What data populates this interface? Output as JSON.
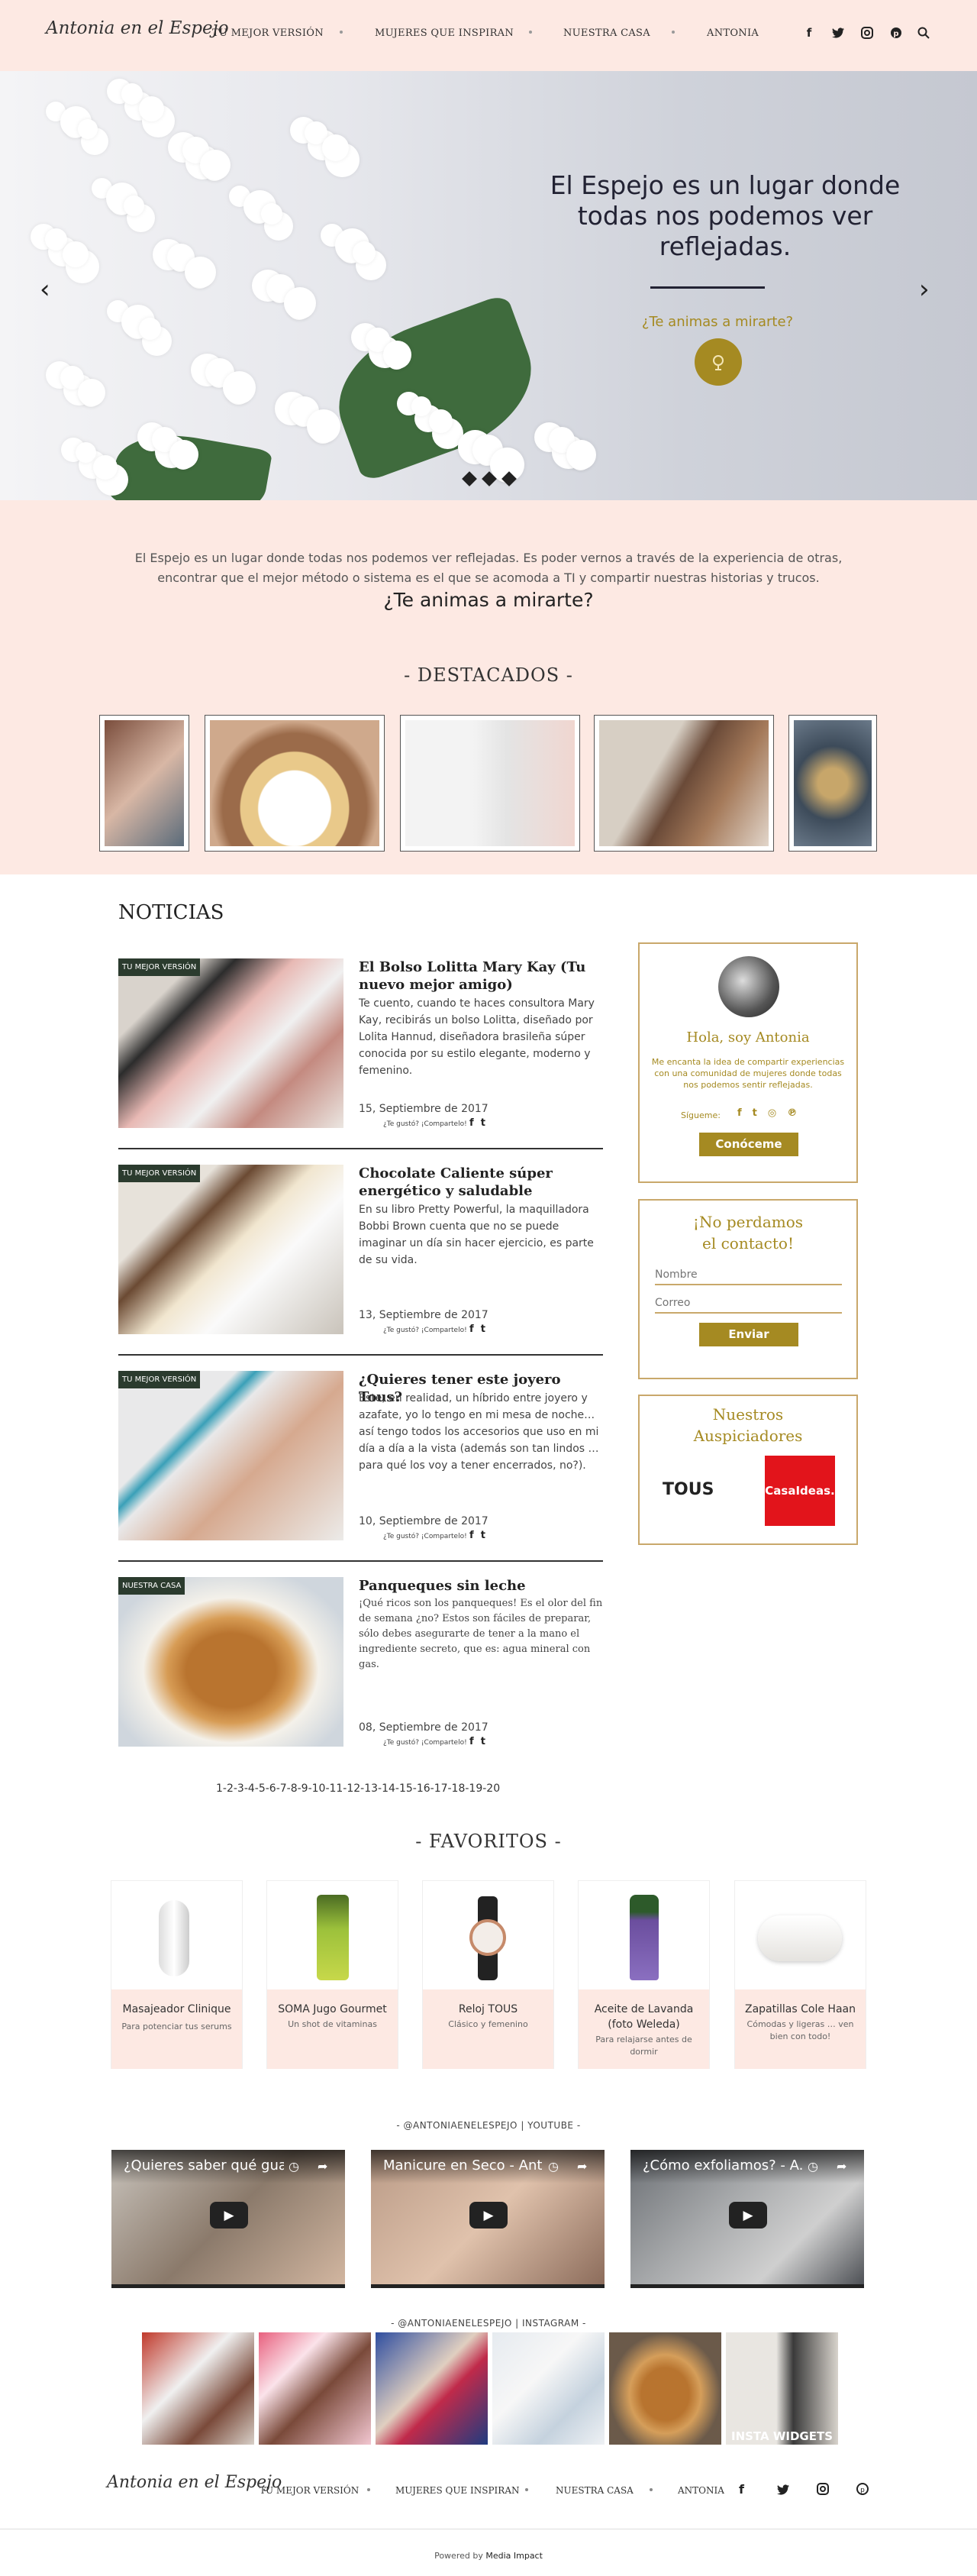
{
  "header": {
    "logo": "Antonia en el Espejo",
    "nav": [
      "TU MEJOR VERSIÓN",
      "MUJERES QUE INSPIRAN",
      "NUESTRA CASA",
      "ANTONIA"
    ],
    "social_icons": [
      "facebook-icon",
      "twitter-icon",
      "instagram-icon",
      "pinterest-icon",
      "search-icon"
    ]
  },
  "hero": {
    "title": "El Espejo es un lugar donde todas nos podemos ver reflejadas.",
    "ask": "¿Te animas a mirarte?",
    "prev": "‹",
    "next": "›"
  },
  "intro": {
    "text": "El Espejo es un lugar donde todas nos podemos ver reflejadas. Es poder vernos a través de la experiencia de otras, encontrar que el mejor método o sistema es el que se acomoda a TI y compartir nuestras historias y trucos.",
    "ask": "¿Te animas a mirarte?",
    "featured_title": "- DESTACADOS -"
  },
  "news": {
    "title": "NOTICIAS",
    "share_label": "¿Te gustó? ¡Compartelo!",
    "posts": [
      {
        "tag": "TU MEJOR VERSIÓN",
        "title": "El Bolso Lolitta Mary Kay (Tu nuevo mejor amigo)",
        "excerpt": "Te cuento, cuando te haces consultora Mary Kay, recibirás un bolso Lolitta, diseñado por Lolita Hannud, diseñadora brasileña súper conocida por su estilo elegante, moderno y femenino.",
        "date": "15, Septiembre de 2017"
      },
      {
        "tag": "TU MEJOR VERSIÓN",
        "title": "Chocolate Caliente súper energético y saludable",
        "excerpt": "En su libro Pretty Powerful, la maquilladora Bobbi Brown cuenta que no se puede imaginar un día sin hacer ejercicio, es parte de su vida.",
        "date": "13, Septiembre de 2017"
      },
      {
        "tag": "TU MEJOR VERSIÓN",
        "title": "¿Quieres tener este joyero Tous?",
        "excerpt": "Este, en realidad, un híbrido entre joyero y azafate, yo lo tengo en mi mesa de noche…así tengo todos los accesorios que uso en mi día a día a la vista (además son tan lindos … para qué los voy a tener encerrados, no?).",
        "date": "10, Septiembre de 2017"
      },
      {
        "tag": "NUESTRA CASA",
        "title": "Panqueques sin leche",
        "excerpt": "¡Qué ricos son los panqueques! Es el olor del fin de semana ¿no? Estos son fáciles de preparar, sólo debes asegurarte de tener a la mano el ingrediente secreto, que es: agua mineral con gas.",
        "date": "08, Septiembre de 2017"
      }
    ],
    "pagination": "1-2-3-4-5-6-7-8-9-10-11-12-13-14-15-16-17-18-19-20"
  },
  "sidebar": {
    "hello": "Hola, soy Antonia",
    "about": "Me encanta la idea de compartir experiencias con una comunidad de mujeres donde todas nos podemos sentir reflejadas.",
    "follow": "Sígueme:",
    "about_btn": "Conóceme",
    "contact_title": "¡No perdamos el contacto!",
    "name_ph": "Nombre",
    "email_ph": "Correo",
    "send_btn": "Enviar",
    "sponsors_title": "Nuestros Auspiciadores",
    "sponsor1": "TOUS",
    "sponsor2": "CasaIdeas."
  },
  "favorites": {
    "title": "- FAVORITOS -",
    "items": [
      {
        "name": "Masajeador Clinique",
        "desc": "Para potenciar tus serums"
      },
      {
        "name": "SOMA Jugo Gourmet",
        "desc": "Un shot de vitaminas"
      },
      {
        "name": "Reloj TOUS",
        "desc": "Clásico y femenino"
      },
      {
        "name": "Aceite de Lavanda (foto Weleda)",
        "desc": "Para relajarse antes de dormir"
      },
      {
        "name": "Zapatillas Cole Haan",
        "desc": "Cómodas y ligeras … ven bien con todo!"
      }
    ]
  },
  "youtube": {
    "title": "- @ANTONIAENELESPEJO | YOUTUBE -",
    "videos": [
      "¿Quieres saber qué guar...",
      "Manicure en Seco - Ant...",
      "¿Cómo exfoliamos? - A..."
    ]
  },
  "instagram": {
    "title": "- @ANTONIAENELESPEJO | INSTAGRAM -",
    "widget": "INSTA WIDGETS"
  },
  "footer": {
    "logo": "Antonia en el Espejo",
    "nav": [
      "TU MEJOR VERSIÓN",
      "MUJERES QUE INSPIRAN",
      "NUESTRA CASA",
      "ANTONIA"
    ],
    "powered": "Powered by",
    "powered_by": "Media Impact"
  },
  "colors": {
    "accent": "#a58a22",
    "pink": "#fde9e3",
    "dark": "#2b3b2e"
  }
}
